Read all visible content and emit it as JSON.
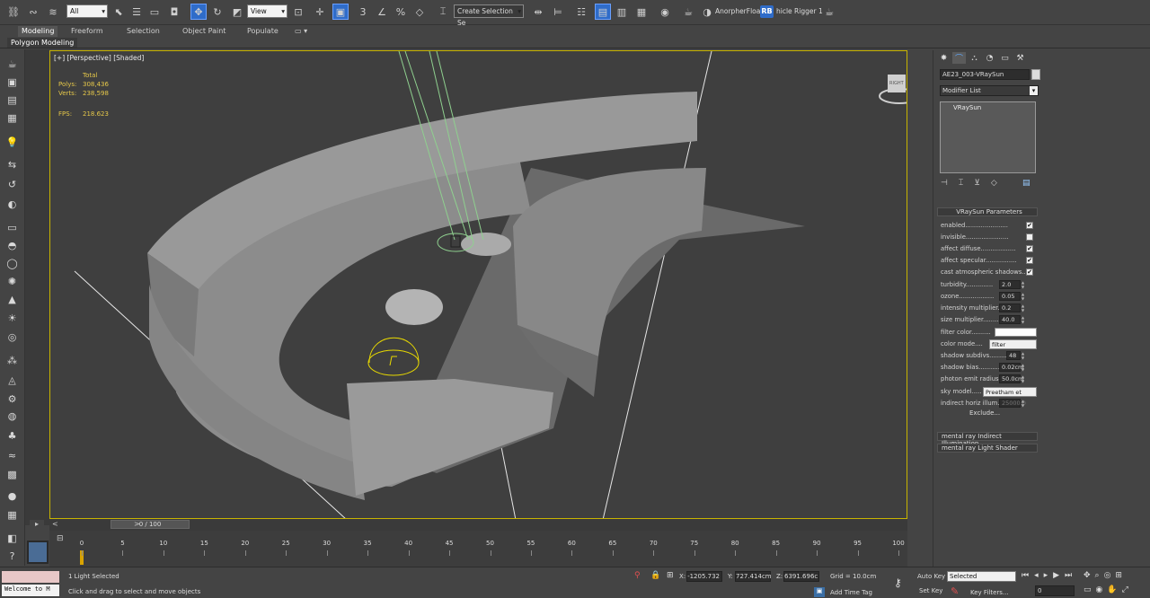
{
  "toolbar": {
    "filter_value": "All",
    "view_value": "View",
    "selection_set_placeholder": "Create Selection Se",
    "plugin1_label": "AnorpherFloater",
    "plugin2_badge": "RB",
    "plugin2_label": "hicle Rigger 1",
    "snap_label": "3",
    "percent_label": "%"
  },
  "ribbon": {
    "tabs": [
      "Modeling",
      "Freeform",
      "Selection",
      "Object Paint",
      "Populate"
    ],
    "active_panel": "Polygon Modeling"
  },
  "viewport": {
    "label": "[+] [Perspective] [Shaded]",
    "stats_header": "Total",
    "polys_label": "Polys:",
    "polys_value": "308,436",
    "verts_label": "Verts:",
    "verts_value": "238,598",
    "fps_label": "FPS:",
    "fps_value": "218.623",
    "viewcube_label": "RIGHT"
  },
  "command_panel": {
    "object_name": "AE23_003-VRaySun",
    "modifier_list_label": "Modifier List",
    "stack_item": "VRaySun",
    "rollout_title": "VRaySun Parameters",
    "checkbox_params": [
      {
        "label": "enabled......................",
        "checked": true
      },
      {
        "label": "invisible......................",
        "checked": false
      },
      {
        "label": "affect diffuse..................",
        "checked": true
      },
      {
        "label": "affect specular................",
        "checked": true
      },
      {
        "label": "cast atmospheric shadows...",
        "checked": true
      }
    ],
    "spinner_params": [
      {
        "label": "turbidity..............",
        "value": "2.0"
      },
      {
        "label": "ozone..................",
        "value": "0.05"
      },
      {
        "label": "intensity multiplier...",
        "value": "0.2"
      },
      {
        "label": "size multiplier........",
        "value": "40.0"
      }
    ],
    "filter_color_label": "filter color..........",
    "color_mode_label": "color mode....",
    "color_mode_value": "filter",
    "spinner_params2": [
      {
        "label": "shadow subdivs.........",
        "value": "48"
      },
      {
        "label": "shadow bias............",
        "value": "0.02cm"
      },
      {
        "label": "photon emit radius.",
        "value": "50.0cm"
      }
    ],
    "sky_model_label": "sky model.....",
    "sky_model_value": "Preetham et",
    "indirect_label": "indirect horiz illum.",
    "indirect_value": "25000.0",
    "exclude_label": "Exclude...",
    "rollout2": "mental ray Indirect Illumination",
    "rollout3": "mental ray Light Shader"
  },
  "timeline": {
    "frame_display": "0 / 100",
    "ticks": [
      "0",
      "5",
      "10",
      "15",
      "20",
      "25",
      "30",
      "35",
      "40",
      "45",
      "50",
      "55",
      "60",
      "65",
      "70",
      "75",
      "80",
      "85",
      "90",
      "95",
      "100"
    ]
  },
  "status": {
    "maxscript_text": "Welcome to M",
    "selection_text": "1 Light Selected",
    "prompt_text": "Click and drag to select and move objects",
    "x_label": "X:",
    "x_value": "-1205.732",
    "y_label": "Y:",
    "y_value": "727.414cm",
    "z_label": "Z:",
    "z_value": "6391.696c",
    "grid_text": "Grid = 10.0cm",
    "add_time_tag": "Add Time Tag",
    "auto_key_label": "Auto Key",
    "auto_key_value": "Selected",
    "set_key_label": "Set Key",
    "key_filters_label": "Key Filters...",
    "frame_value": "0"
  }
}
